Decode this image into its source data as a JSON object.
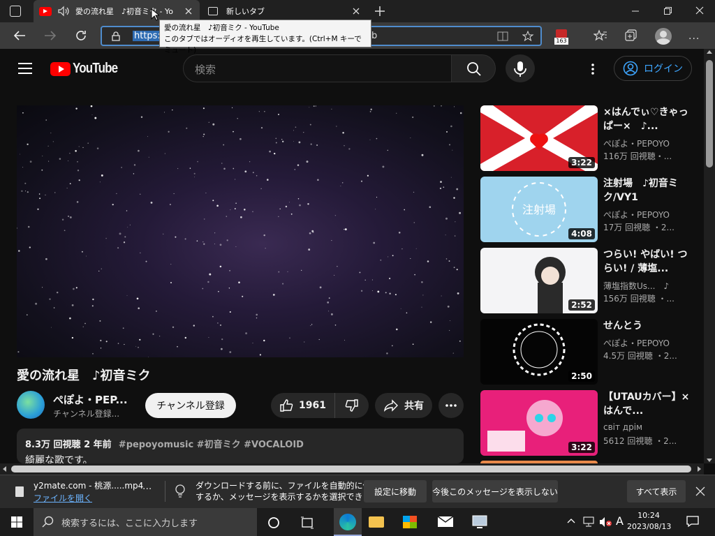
{
  "browser": {
    "tabs": [
      {
        "label": "愛の流れ星　♪初音ミク - Yo"
      },
      {
        "label": "新しいタブ"
      }
    ],
    "url_selected": "https:",
    "url_tail": "b",
    "tooltip_line1": "愛の流れ星　♪初音ミク - YouTube",
    "tooltip_line2": "このタブではオーディオを再生しています。(Ctrl+M キーでミュート)",
    "ext_badge": "163"
  },
  "youtube": {
    "logo_text": "YouTube",
    "search_placeholder": "検索",
    "login_label": "ログイン",
    "video_title": "愛の流れ星　♪初音ミク",
    "channel_name": "ぺぽよ・PEP...",
    "channel_sub": "チャンネル登録...",
    "subscribe_label": "チャンネル登録",
    "like_count": "1961",
    "share_label": "共有",
    "desc_meta": "8.3万 回視聴  2 年前",
    "desc_tags": "#pepoyomusic #初音ミク #VOCALOID",
    "desc_text": "綺麗な歌です。"
  },
  "recommendations": [
    {
      "title": "×はんでぃ♡きゃっぱー×　♪...",
      "channel": "ぺぽよ・PEPOYO",
      "meta": "116万 回視聴・...",
      "duration": "3:22",
      "bg": "#d8202a"
    },
    {
      "title": "注射場　♪初音ミク/VY1",
      "channel": "ぺぽよ・PEPOYO",
      "meta": "17万 回視聴 ・2...",
      "duration": "4:08",
      "bg": "#9fd4ee"
    },
    {
      "title": "つらい! やばい! つらい! / 薄塩...",
      "channel": "薄塩指数Us...　♪",
      "meta": "156万 回視聴 ・...",
      "duration": "2:52",
      "bg": "#f4f4f6"
    },
    {
      "title": "せんとう",
      "channel": "ぺぽよ・PEPOYO",
      "meta": "4.5万 回視聴 ・2...",
      "duration": "2:50",
      "bg": "#050505"
    },
    {
      "title": "【UTAUカバー】×はんで...",
      "channel": "світ дрім",
      "meta": "5612 回視聴 ・2...",
      "duration": "3:22",
      "bg": "#e8207a"
    }
  ],
  "download": {
    "filename": "y2mate.com - 桃源.....mp4",
    "open_link": "ファイルを開く",
    "message_line1": "ダウンロードする前に、ファイルを自動的に保存",
    "message_line2": "するか、メッセージを表示するかを選択できます。",
    "settings_btn": "設定に移動",
    "dismiss_btn": "今後このメッセージを表示しない",
    "show_all_btn": "すべて表示"
  },
  "taskbar": {
    "search_placeholder": "検索するには、ここに入力します",
    "ime": "A",
    "time": "10:24",
    "date": "2023/08/13"
  }
}
